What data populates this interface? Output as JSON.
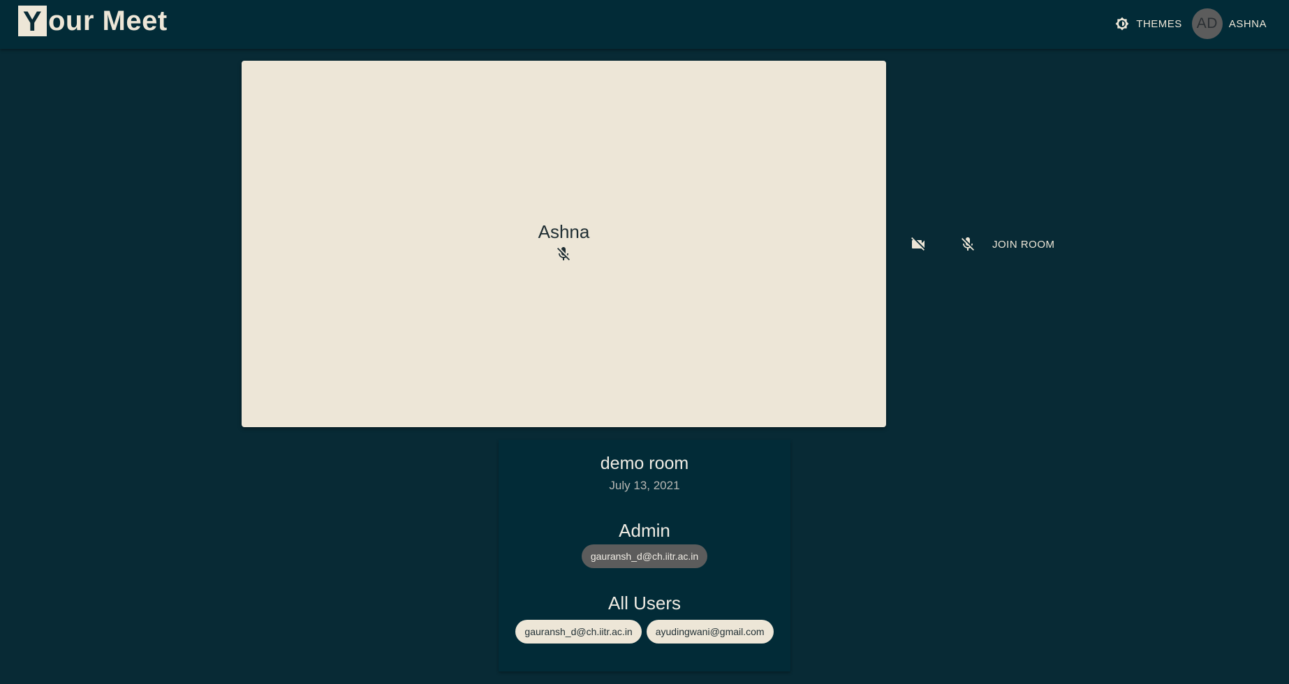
{
  "header": {
    "logo_initial": "Y",
    "logo_rest": "our Meet",
    "themes_label": "THEMES",
    "avatar_initials": "AD",
    "user_name": "ASHNA"
  },
  "preview": {
    "participant_name": "Ashna",
    "icons": {
      "participant_mic": "mic-off-icon",
      "camera_toggle": "videocam-off-icon",
      "mic_toggle": "mic-off-icon",
      "themes": "brightness-icon"
    }
  },
  "controls": {
    "join_label": "JOIN ROOM"
  },
  "room": {
    "name": "demo room",
    "date": "July 13, 2021",
    "admin_heading": "Admin",
    "admins": [
      "gauransh_d@ch.iitr.ac.in"
    ],
    "users_heading": "All Users",
    "users": [
      "gauransh_d@ch.iitr.ac.in",
      "ayudingwani@gmail.com"
    ]
  },
  "colors": {
    "background": "#082a35",
    "appbar": "#022b37",
    "cream": "#ede6d7",
    "chip_dark": "#5c5c5c"
  }
}
